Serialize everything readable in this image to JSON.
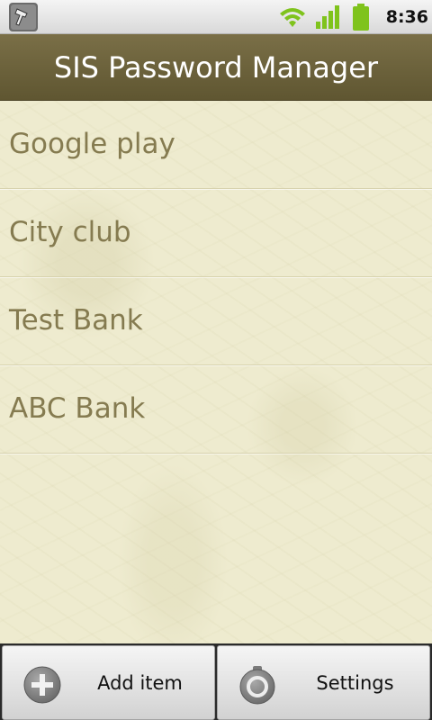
{
  "status_bar": {
    "time": "8:36",
    "icons": [
      "notification-tool-icon",
      "wifi-icon",
      "signal-icon",
      "battery-icon"
    ],
    "accent_color": "#7fc31c"
  },
  "title_bar": {
    "title": "SIS Password Manager",
    "background_color": "#6b6240"
  },
  "items": [
    {
      "label": "Google play"
    },
    {
      "label": "City club"
    },
    {
      "label": "Test Bank"
    },
    {
      "label": "ABC Bank"
    }
  ],
  "buttons": {
    "add": {
      "label": "Add item",
      "icon": "plus-circle-icon"
    },
    "settings": {
      "label": "Settings",
      "icon": "gear-icon"
    }
  }
}
